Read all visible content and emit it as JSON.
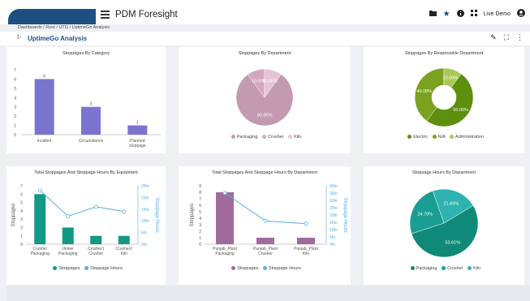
{
  "app": {
    "title": "PDM Foresight",
    "user_label": "Live Demo"
  },
  "breadcrumb": [
    "Dashboards",
    "Root",
    "UTG",
    "UptimeGo Analysis"
  ],
  "breadcrumb_text": "Dashboards  /  Root  /  UTG  /  UptimeGo Analysis",
  "page": {
    "title": "UptimeGo Analysis"
  },
  "toolbar": {
    "icons": [
      "folder-icon",
      "star-icon",
      "info-icon",
      "apps-icon",
      "account-icon"
    ]
  },
  "page_actions": {
    "icons": [
      "edit-icon",
      "fullscreen-icon",
      "more-icon"
    ]
  },
  "colors": {
    "brand": "#1d4f82",
    "bar_purple": "#7b74cf",
    "pink": "#c49ab0",
    "pink_light": "#e0b4cc",
    "green_dark": "#5e8f0f",
    "green": "#7aa21f",
    "green_light": "#a9c956",
    "teal": "#119985",
    "teal_dark": "#0f7d72",
    "teal_mid": "#27aaa6",
    "sky": "#5aaee0",
    "mauve": "#a06b9c"
  },
  "chart_data": [
    {
      "id": "category",
      "type": "bar",
      "title": "Stoppages By Category",
      "categories": [
        "Incident",
        "Circumstance",
        "Planned stoppage"
      ],
      "values": [
        6,
        3,
        1
      ],
      "ylim": [
        0,
        7
      ],
      "yticks": [
        0,
        1,
        2,
        3,
        4,
        5,
        6,
        7
      ],
      "data_labels": true
    },
    {
      "id": "department",
      "type": "pie",
      "title": "Stoppages By Department",
      "labels": [
        "Packaging",
        "Crusher",
        "Kiln"
      ],
      "values": [
        80,
        10,
        10
      ],
      "value_labels": [
        "80.00%",
        "10.00%",
        "10.00%"
      ],
      "colors": [
        "#c49ab0",
        "#d6a6c0",
        "#e7c3d6"
      ],
      "legend": "bottom"
    },
    {
      "id": "responsible",
      "type": "pie",
      "donut": true,
      "title": "Stoppages By Responsible Department",
      "labels": [
        "Electric",
        "N/A",
        "Administration"
      ],
      "values": [
        50,
        40,
        10
      ],
      "value_labels": [
        "50.00%",
        "40.00%",
        "10.00%"
      ],
      "colors": [
        "#5e8f0f",
        "#7aa21f",
        "#a9c956"
      ],
      "legend": "bottom"
    },
    {
      "id": "equipment",
      "type": "bar",
      "title": "Total Stoppages And Stoppage Hours By Equipment",
      "categories": [
        [
          "Crusher",
          "Packaging"
        ],
        [
          "clinker",
          "Packaging"
        ],
        [
          "Crusher1",
          "Crusher"
        ],
        [
          "Crusher2",
          "Kiln"
        ]
      ],
      "series": [
        {
          "name": "Stoppages",
          "kind": "bar",
          "values": [
            6,
            2,
            1,
            1
          ]
        },
        {
          "name": "Stoppage Hours",
          "kind": "line",
          "values": [
            23,
            12,
            16,
            14
          ]
        }
      ],
      "ylabel": "Stoppages",
      "ylabel2": "Stoppage Hours",
      "ylim": [
        0,
        7
      ],
      "yticks": [
        0,
        1,
        2,
        3,
        4,
        5,
        6,
        7
      ],
      "ylim2": [
        0,
        25
      ],
      "yticks2": [
        "0hr",
        "5hr",
        "10hr",
        "15hr",
        "20hr",
        "25hr"
      ],
      "legend": "bottom"
    },
    {
      "id": "dept_hours",
      "type": "bar",
      "title": "Total Stoppages And Stoppage Hours By Department",
      "categories": [
        [
          "Punjab_Plant",
          "Packaging"
        ],
        [
          "Punjab_Plant",
          "Crusher"
        ],
        [
          "Punjab_Plant",
          "Kiln"
        ]
      ],
      "series": [
        {
          "name": "Stoppages",
          "kind": "bar",
          "values": [
            8,
            1,
            1
          ]
        },
        {
          "name": "Stoppage Hours",
          "kind": "line",
          "values": [
            35,
            16,
            14
          ]
        }
      ],
      "ylabel": "Stoppages",
      "ylabel2": "Stoppage Hours",
      "ylim": [
        0,
        9
      ],
      "yticks": [
        0,
        1,
        2,
        3,
        4,
        5,
        6,
        7,
        8,
        9
      ],
      "ylim2": [
        0,
        40
      ],
      "yticks2": [
        "0hr",
        "5hr",
        "10hr",
        "15hr",
        "20hr",
        "25hr",
        "30hr",
        "35hr",
        "40hr"
      ],
      "legend": "bottom"
    },
    {
      "id": "hours_dept",
      "type": "pie",
      "title": "Stoppage Hours By Department",
      "labels": [
        "Packaging",
        "Crusher",
        "Kiln"
      ],
      "values": [
        53.61,
        24.7,
        21.69
      ],
      "value_labels": [
        "53.61%",
        "24.70%",
        "21.69%"
      ],
      "colors": [
        "#0f8a78",
        "#1a9d93",
        "#2fb3b0"
      ],
      "legend": "bottom"
    }
  ]
}
